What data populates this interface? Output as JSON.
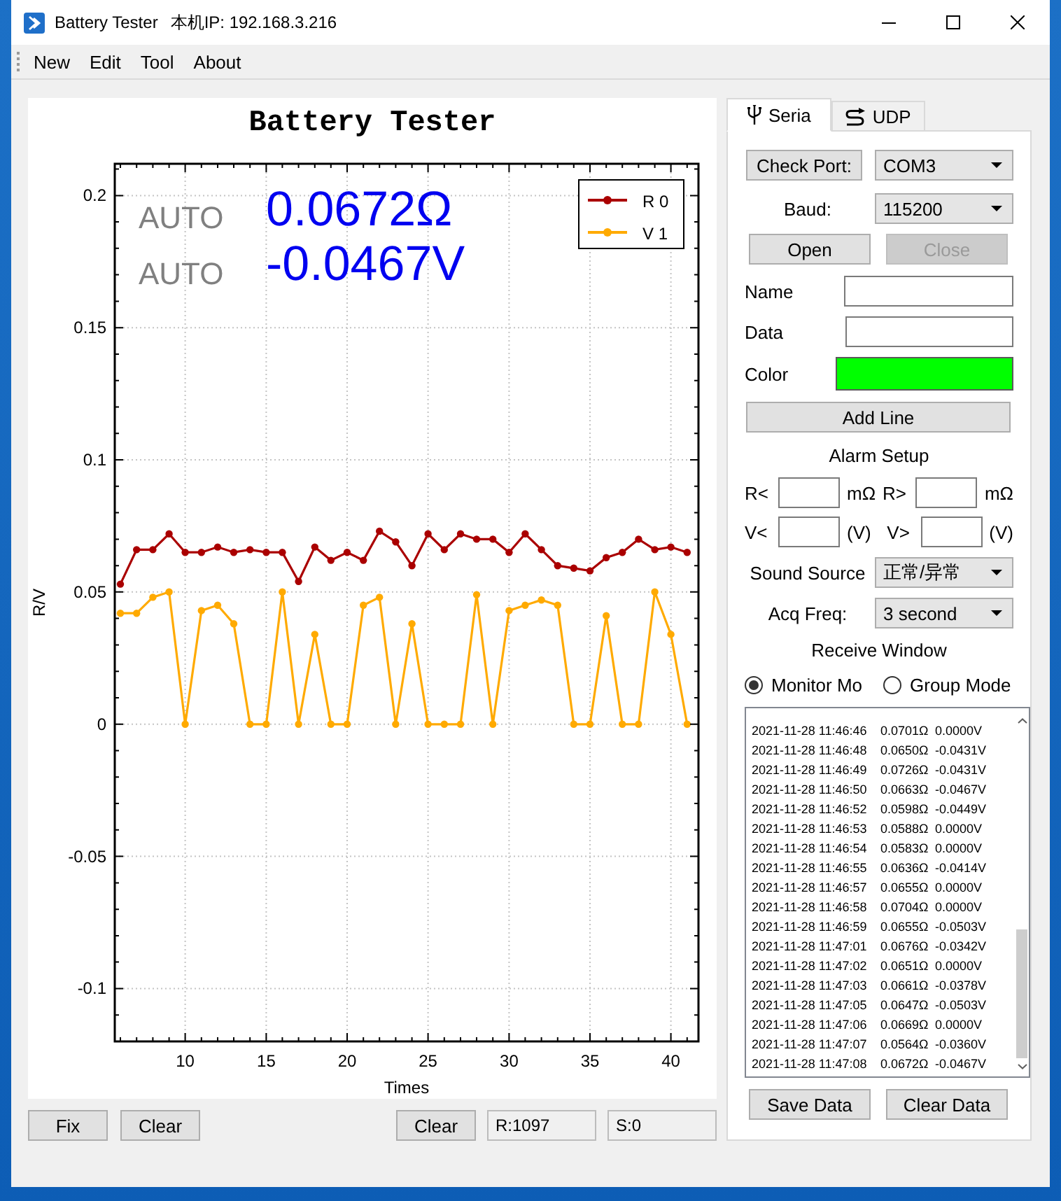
{
  "window": {
    "title": "Battery Tester",
    "subtitle": "本机IP: 192.168.3.216"
  },
  "menu": [
    {
      "label": "New"
    },
    {
      "label": "Edit"
    },
    {
      "label": "Tool"
    },
    {
      "label": "About"
    }
  ],
  "chart": {
    "readouts": [
      {
        "mode": "AUTO",
        "value": "0.0672Ω"
      },
      {
        "mode": "AUTO",
        "value": "-0.0467V"
      }
    ],
    "chart_data": {
      "type": "line",
      "title": "Battery Tester",
      "xlabel": "Times",
      "ylabel": "R/V",
      "legend": true,
      "x": [
        6,
        7,
        8,
        9,
        10,
        11,
        12,
        13,
        14,
        15,
        16,
        17,
        18,
        19,
        20,
        21,
        22,
        23,
        24,
        25,
        26,
        27,
        28,
        29,
        30,
        31,
        32,
        33,
        34,
        35,
        36,
        37,
        38,
        39,
        40,
        41
      ],
      "series": [
        {
          "name": "R 0",
          "color": "#aa0000",
          "marker": "circle",
          "values": [
            0.053,
            0.066,
            0.066,
            0.072,
            0.065,
            0.065,
            0.067,
            0.065,
            0.066,
            0.065,
            0.065,
            0.054,
            0.067,
            0.062,
            0.065,
            0.062,
            0.073,
            0.069,
            0.06,
            0.072,
            0.066,
            0.072,
            0.07,
            0.07,
            0.065,
            0.072,
            0.066,
            0.06,
            0.059,
            0.058,
            0.063,
            0.065,
            0.07,
            0.066,
            0.067,
            0.065
          ]
        },
        {
          "name": "V 1",
          "color": "#ffaa00",
          "marker": "circle",
          "values": [
            0.042,
            0.042,
            0.048,
            0.05,
            0,
            0.043,
            0.045,
            0.038,
            0,
            0,
            0.05,
            0,
            0.034,
            0,
            0,
            0.045,
            0.048,
            0,
            0.038,
            0,
            0,
            0,
            0.049,
            0,
            0.043,
            0.045,
            0.047,
            0.045,
            0,
            0,
            0.041,
            0,
            0,
            0.05,
            0.034,
            0
          ]
        }
      ],
      "xlim": [
        5.65,
        41.7
      ],
      "ylim": [
        -0.12,
        0.212
      ],
      "xticks": [
        10,
        15,
        20,
        25,
        30,
        35,
        40
      ],
      "yticks": [
        -0.1,
        -0.05,
        0,
        0.05,
        0.1,
        0.15,
        0.2
      ]
    }
  },
  "chart_controls": {
    "fix": "Fix",
    "clear_chart": "Clear",
    "clear_counts": "Clear",
    "counters": [
      "R:1097",
      "S:0"
    ]
  },
  "tabs": [
    {
      "label": "Seria",
      "selected": true,
      "kind": "usb"
    },
    {
      "label": "UDP",
      "selected": false,
      "kind": "network"
    }
  ],
  "serial": {
    "check_port": "Check Port:",
    "port": "COM3",
    "baud_label": "Baud:",
    "baud": "115200",
    "buttons": [
      {
        "label": "Open",
        "disabled": false
      },
      {
        "label": "Close",
        "disabled": true
      }
    ]
  },
  "line": {
    "name_label": "Name",
    "data_label": "Data",
    "color_label": "Color",
    "color": "#00ff00",
    "add_button": "Add Line"
  },
  "alarm": {
    "title": "Alarm Setup",
    "limits": [
      {
        "label": "R<",
        "unit": "mΩ"
      },
      {
        "label": "R>",
        "unit": "mΩ"
      },
      {
        "label": "V<",
        "unit": "(V)"
      },
      {
        "label": "V>",
        "unit": "(V)"
      }
    ],
    "sound_label": "Sound Source",
    "sound": "正常/异常",
    "freq_label": "Acq Freq:",
    "freq": "3 second"
  },
  "receive": {
    "title": "Receive Window",
    "modes": [
      {
        "label": "Monitor Mo",
        "selected": true
      },
      {
        "label": "Group Mode",
        "selected": false
      }
    ],
    "log": [
      {
        "time": "2021-11-28 11:46:46",
        "r": "0.0701Ω",
        "v": "0.0000V"
      },
      {
        "time": "2021-11-28 11:46:48",
        "r": "0.0650Ω",
        "v": "-0.0431V"
      },
      {
        "time": "2021-11-28 11:46:49",
        "r": "0.0726Ω",
        "v": "-0.0431V"
      },
      {
        "time": "2021-11-28 11:46:50",
        "r": "0.0663Ω",
        "v": "-0.0467V"
      },
      {
        "time": "2021-11-28 11:46:52",
        "r": "0.0598Ω",
        "v": "-0.0449V"
      },
      {
        "time": "2021-11-28 11:46:53",
        "r": "0.0588Ω",
        "v": "0.0000V"
      },
      {
        "time": "2021-11-28 11:46:54",
        "r": "0.0583Ω",
        "v": "0.0000V"
      },
      {
        "time": "2021-11-28 11:46:55",
        "r": "0.0636Ω",
        "v": "-0.0414V"
      },
      {
        "time": "2021-11-28 11:46:57",
        "r": "0.0655Ω",
        "v": "0.0000V"
      },
      {
        "time": "2021-11-28 11:46:58",
        "r": "0.0704Ω",
        "v": "0.0000V"
      },
      {
        "time": "2021-11-28 11:46:59",
        "r": "0.0655Ω",
        "v": "-0.0503V"
      },
      {
        "time": "2021-11-28 11:47:01",
        "r": "0.0676Ω",
        "v": "-0.0342V"
      },
      {
        "time": "2021-11-28 11:47:02",
        "r": "0.0651Ω",
        "v": "0.0000V"
      },
      {
        "time": "2021-11-28 11:47:03",
        "r": "0.0661Ω",
        "v": "-0.0378V"
      },
      {
        "time": "2021-11-28 11:47:05",
        "r": "0.0647Ω",
        "v": "-0.0503V"
      },
      {
        "time": "2021-11-28 11:47:06",
        "r": "0.0669Ω",
        "v": "0.0000V"
      },
      {
        "time": "2021-11-28 11:47:07",
        "r": "0.0564Ω",
        "v": "-0.0360V"
      },
      {
        "time": "2021-11-28 11:47:08",
        "r": "0.0672Ω",
        "v": "-0.0467V"
      }
    ],
    "save_button": "Save Data",
    "clear_button": "Clear Data"
  }
}
